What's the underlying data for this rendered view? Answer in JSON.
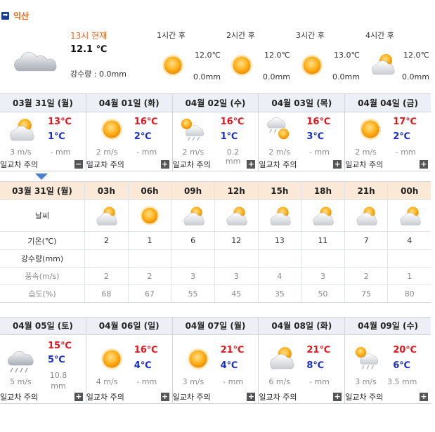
{
  "location": {
    "name": "익산",
    "arrow_glyph": "➡"
  },
  "current": {
    "title": "13시 현재",
    "temp": "12.1 ℃",
    "rain": "강수량 : 0.0mm",
    "icon": "cloudy-icon"
  },
  "forecast": [
    {
      "hour": "1시간 후",
      "temp": "12.0℃",
      "rain": "0.0mm",
      "icon": "sunny-icon"
    },
    {
      "hour": "2시간 후",
      "temp": "12.0℃",
      "rain": "0.0mm",
      "icon": "sunny-icon"
    },
    {
      "hour": "3시간 후",
      "temp": "13.0℃",
      "rain": "0.0mm",
      "icon": "sunny-icon"
    },
    {
      "hour": "4시간 후",
      "temp": "12.0℃",
      "rain": "0.0mm",
      "icon": "partly-cloudy-icon"
    }
  ],
  "week1": [
    {
      "date": "03월 31일 (월)",
      "hi": "13℃",
      "lo": "1℃",
      "wind": "3 m/s",
      "rain": "- mm",
      "note": "일교차 주의",
      "toggle": "−",
      "icon": "partly-cloudy-icon"
    },
    {
      "date": "04월 01일 (화)",
      "hi": "16℃",
      "lo": "2℃",
      "wind": "2 m/s",
      "rain": "- mm",
      "note": "일교차 주의",
      "toggle": "+",
      "icon": "sunny-icon"
    },
    {
      "date": "04월 02일 (수)",
      "hi": "16℃",
      "lo": "1℃",
      "wind": "2 m/s",
      "rain": "0.2 mm",
      "note": "일교차 주의",
      "toggle": "+",
      "icon": "sun-rain-icon"
    },
    {
      "date": "04월 03일 (목)",
      "hi": "16℃",
      "lo": "3℃",
      "wind": "2 m/s",
      "rain": "- mm",
      "note": "일교차 주의",
      "toggle": "+",
      "icon": "rain-sun-icon"
    },
    {
      "date": "04월 04일 (금)",
      "hi": "17℃",
      "lo": "2℃",
      "wind": "2 m/s",
      "rain": "- mm",
      "note": "일교차 주의",
      "toggle": "+",
      "icon": "sunny-icon"
    }
  ],
  "hourly": {
    "date": "03월 31일 (월)",
    "hours": [
      "03h",
      "06h",
      "09h",
      "12h",
      "15h",
      "18h",
      "21h",
      "00h"
    ],
    "weather_label": "날씨",
    "icons": [
      "partly-cloudy-icon",
      "sunny-icon",
      "partly-cloudy-icon",
      "partly-cloudy-icon",
      "partly-cloudy-icon",
      "partly-cloudy-icon",
      "partly-cloudy-icon",
      "partly-cloudy-icon"
    ],
    "temp_label": "기온(℃)",
    "temps": [
      "2",
      "1",
      "6",
      "12",
      "13",
      "11",
      "7",
      "4"
    ],
    "rain_label": "강수량(mm)",
    "rains": [
      "",
      "",
      "",
      "",
      "",
      "",
      "",
      ""
    ],
    "wind_label": "풍속(m/s)",
    "winds": [
      "2",
      "2",
      "3",
      "3",
      "4",
      "3",
      "2",
      "1"
    ],
    "humid_label": "습도(%)",
    "humids": [
      "68",
      "67",
      "55",
      "45",
      "35",
      "50",
      "75",
      "80"
    ]
  },
  "week2": [
    {
      "date": "04월 05일 (토)",
      "hi": "15℃",
      "lo": "5℃",
      "wind": "5 m/s",
      "rain": "10.8 mm",
      "note": "일교차 주의",
      "toggle": "+",
      "icon": "rain-icon"
    },
    {
      "date": "04월 06일 (일)",
      "hi": "16℃",
      "lo": "4℃",
      "wind": "4 m/s",
      "rain": "- mm",
      "note": "일교차 주의",
      "toggle": "+",
      "icon": "sunny-icon"
    },
    {
      "date": "04월 07일 (월)",
      "hi": "21℃",
      "lo": "4℃",
      "wind": "3 m/s",
      "rain": "- mm",
      "note": "일교차 주의",
      "toggle": "+",
      "icon": "sunny-icon"
    },
    {
      "date": "04월 08일 (화)",
      "hi": "21℃",
      "lo": "8℃",
      "wind": "6 m/s",
      "rain": "- mm",
      "note": "일교차 주의",
      "toggle": "+",
      "icon": "partly-cloudy-icon"
    },
    {
      "date": "04월 09일 (수)",
      "hi": "20℃",
      "lo": "6℃",
      "wind": "3 m/s",
      "rain": "3.5 mm",
      "note": "일교차 주의",
      "toggle": "+",
      "icon": "sun-rain-icon"
    }
  ],
  "colors": {
    "accent": "#e8641b",
    "hi_temp": "#e8141b",
    "lo_temp": "#1a2fc8",
    "day_header": "#ecf0f6",
    "hour_header": "#fbe9d8"
  }
}
